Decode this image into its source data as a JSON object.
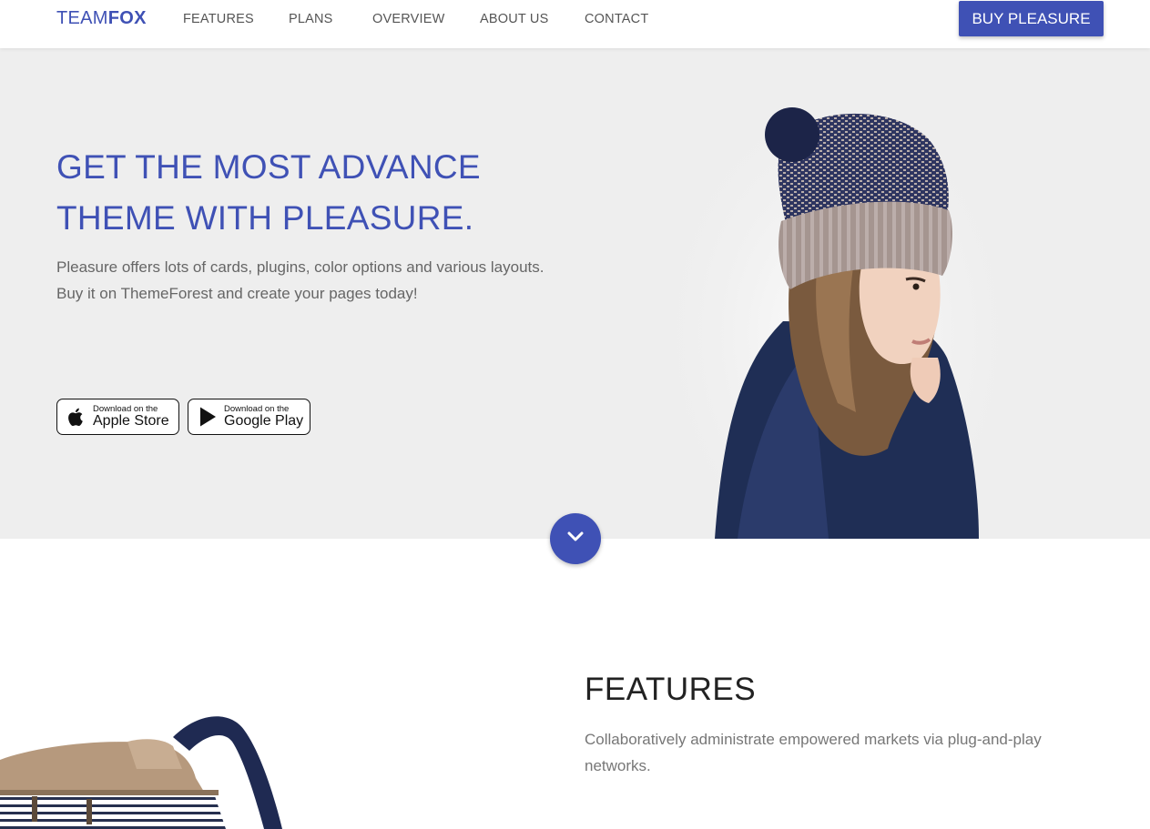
{
  "brand": {
    "light": "TEAM",
    "bold": "FOX"
  },
  "nav": {
    "items": [
      {
        "label": "FEATURES"
      },
      {
        "label": "PLANS"
      },
      {
        "label": "OVERVIEW"
      },
      {
        "label": "ABOUT US"
      },
      {
        "label": "CONTACT"
      }
    ],
    "cta_label": "BUY PLEASURE"
  },
  "hero": {
    "title_line1": "GET THE MOST ADVANCE",
    "title_line2": "THEME WITH PLEASURE.",
    "text_line1": "Pleasure offers lots of cards, plugins, color options and various layouts.",
    "text_line2": "Buy it on ThemeForest and create your pages today!",
    "apple": {
      "small": "Download on the",
      "big": "Apple Store",
      "icon": "apple-icon"
    },
    "google": {
      "small": "Download on the",
      "big": "Google Play",
      "icon": "play-icon"
    }
  },
  "scroll": {
    "icon": "chevron-down-icon"
  },
  "features": {
    "title": "FEATURES",
    "text": "Collaboratively administrate empowered markets via plug-and-play networks."
  },
  "colors": {
    "accent": "#3f51b5",
    "hero_bg": "#eeeeee"
  }
}
